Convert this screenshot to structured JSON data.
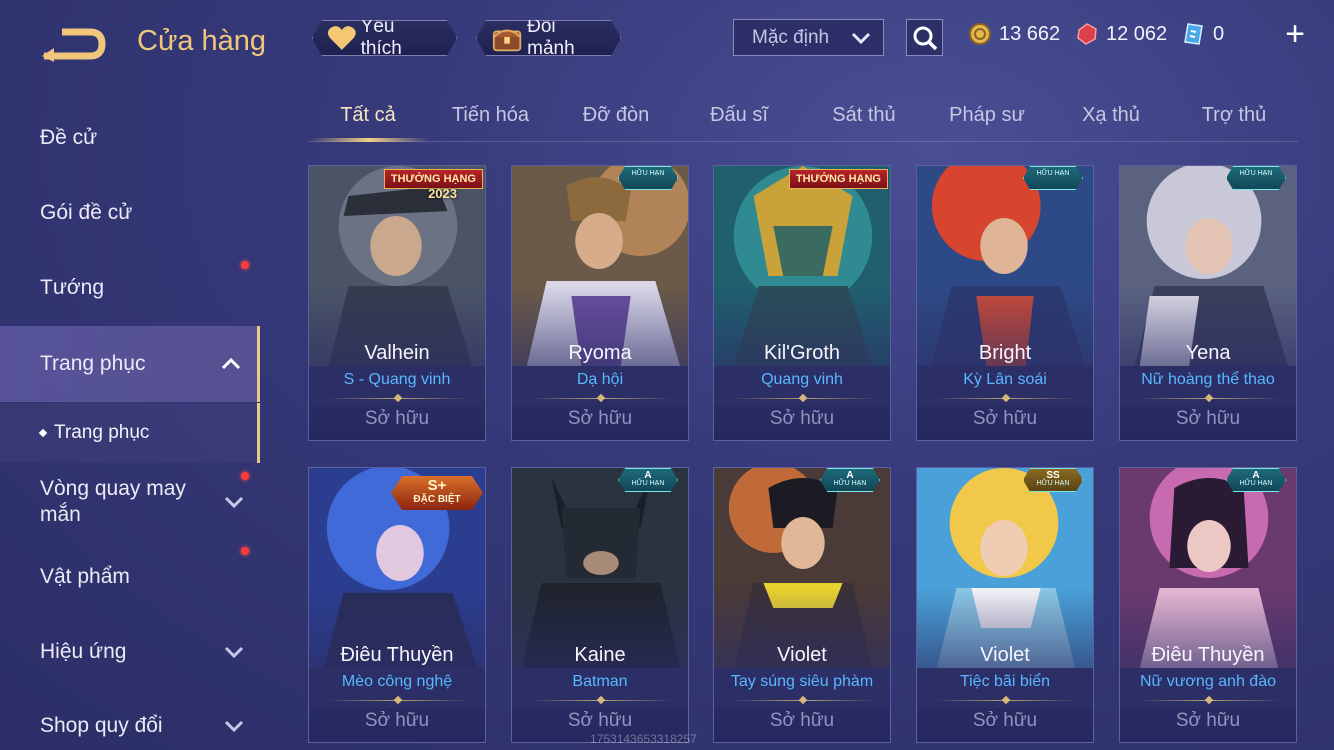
{
  "header": {
    "title": "Cửa hàng",
    "favorite_label": "Yêu thích",
    "exchange_label": "Đổi mảnh",
    "sort_value": "Mặc định",
    "gold": "13 662",
    "ruby": "12 062",
    "coupon": "0"
  },
  "colors": {
    "accent_gold": "#f0c77a",
    "skin_blue": "#58b8ff",
    "notify_red": "#ff3b3b"
  },
  "sidebar": {
    "items": [
      {
        "label": "Đề cử"
      },
      {
        "label": "Gói đề cử"
      },
      {
        "label": "Tướng"
      },
      {
        "label": "Trang phục"
      },
      {
        "label": "Vòng quay may mắn"
      },
      {
        "label": "Vật phẩm"
      },
      {
        "label": "Hiệu ứng"
      },
      {
        "label": "Shop quy đổi"
      }
    ],
    "sub_item": "Trang phục"
  },
  "tabs": [
    "Tất cả",
    "Tiến hóa",
    "Đỡ đòn",
    "Đấu sĩ",
    "Sát thủ",
    "Pháp sư",
    "Xạ thủ",
    "Trợ thủ"
  ],
  "cards": [
    {
      "hero": "Valhein",
      "skin": "S - Quang vinh",
      "status": "Sở hữu",
      "badge": "rank",
      "badge_text": "THƯỞNG HẠNG",
      "badge_year": "2023"
    },
    {
      "hero": "Ryoma",
      "skin": "Dạ hội",
      "status": "Sở hữu",
      "badge": "limited",
      "badge_text": "HỮU HẠN"
    },
    {
      "hero": "Kil'Groth",
      "skin": "Quang vinh",
      "status": "Sở hữu",
      "badge": "rank",
      "badge_text": "THƯỞNG HẠNG"
    },
    {
      "hero": "Bright",
      "skin": "Kỳ Lân soái",
      "status": "Sở hữu",
      "badge": "limited",
      "badge_text": "HỮU HẠN"
    },
    {
      "hero": "Yena",
      "skin": "Nữ hoàng thể thao",
      "status": "Sở hữu",
      "badge": "limited",
      "badge_text": "HỮU HẠN"
    },
    {
      "hero": "Điêu Thuyền",
      "skin": "Mèo công nghệ",
      "status": "Sở hữu",
      "badge": "special",
      "badge_grade": "S+",
      "badge_text": "ĐẶC BIỆT"
    },
    {
      "hero": "Kaine",
      "skin": "Batman",
      "status": "Sở hữu",
      "badge": "limited",
      "badge_grade": "A",
      "badge_text": "HỮU HẠN"
    },
    {
      "hero": "Violet",
      "skin": "Tay súng siêu phàm",
      "status": "Sở hữu",
      "badge": "limited",
      "badge_grade": "A",
      "badge_text": "HỮU HẠN"
    },
    {
      "hero": "Violet",
      "skin": "Tiệc bãi biển",
      "status": "Sở hữu",
      "badge": "limited-gold",
      "badge_grade": "SS",
      "badge_text": "HỮU HẠN"
    },
    {
      "hero": "Điêu Thuyền",
      "skin": "Nữ vương anh đào",
      "status": "Sở hữu",
      "badge": "limited",
      "badge_grade": "A",
      "badge_text": "HỮU HẠN"
    }
  ],
  "watermark": "1753143653318257"
}
